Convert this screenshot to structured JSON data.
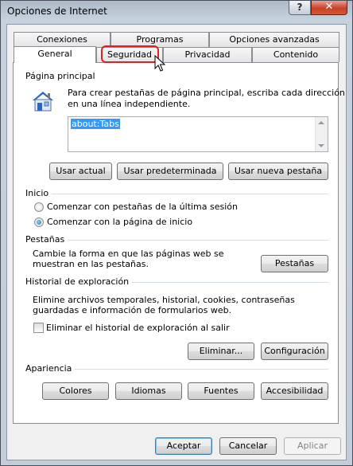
{
  "window": {
    "title": "Opciones de Internet",
    "help_label": "?",
    "close_label": "✕"
  },
  "tabs": {
    "back": [
      "Conexiones",
      "Programas",
      "Opciones avanzadas"
    ],
    "front": [
      "General",
      "Seguridad",
      "Privacidad",
      "Contenido"
    ],
    "active": "General",
    "highlighted": "Seguridad"
  },
  "home_page": {
    "section_label": "Página principal",
    "description": [
      "Para crear pestañas de página principal, escriba cada dirección",
      "en una línea independiente."
    ],
    "url_value": "about:Tabs",
    "buttons": {
      "use_current": "Usar actual",
      "use_default": "Usar predeterminada",
      "use_new_tab": "Usar nueva pestaña"
    }
  },
  "startup": {
    "section_label": "Inicio",
    "options": [
      "Comenzar con pestañas de la última sesión",
      "Comenzar con la página de inicio"
    ],
    "selected_index": 1
  },
  "tabs_section": {
    "section_label": "Pestañas",
    "description": [
      "Cambie la forma en que las páginas web se",
      "muestran en las pestañas."
    ],
    "button": "Pestañas"
  },
  "history": {
    "section_label": "Historial de exploración",
    "description": [
      "Elimine archivos temporales, historial, cookies, contraseñas",
      "guardadas e información de formularios web."
    ],
    "delete_on_exit_label": "Eliminar el historial de exploración al salir",
    "delete_on_exit_checked": false,
    "buttons": {
      "delete": "Eliminar...",
      "settings": "Configuración"
    }
  },
  "appearance": {
    "section_label": "Apariencia",
    "buttons": [
      "Colores",
      "Idiomas",
      "Fuentes",
      "Accesibilidad"
    ]
  },
  "footer": {
    "ok": "Aceptar",
    "cancel": "Cancelar",
    "apply": "Aplicar",
    "apply_enabled": false
  },
  "colors": {
    "highlight_ring": "#e02020",
    "selection": "#3399ff",
    "house_roof": "#2a66c8",
    "house_wall": "#dfe9f8"
  }
}
